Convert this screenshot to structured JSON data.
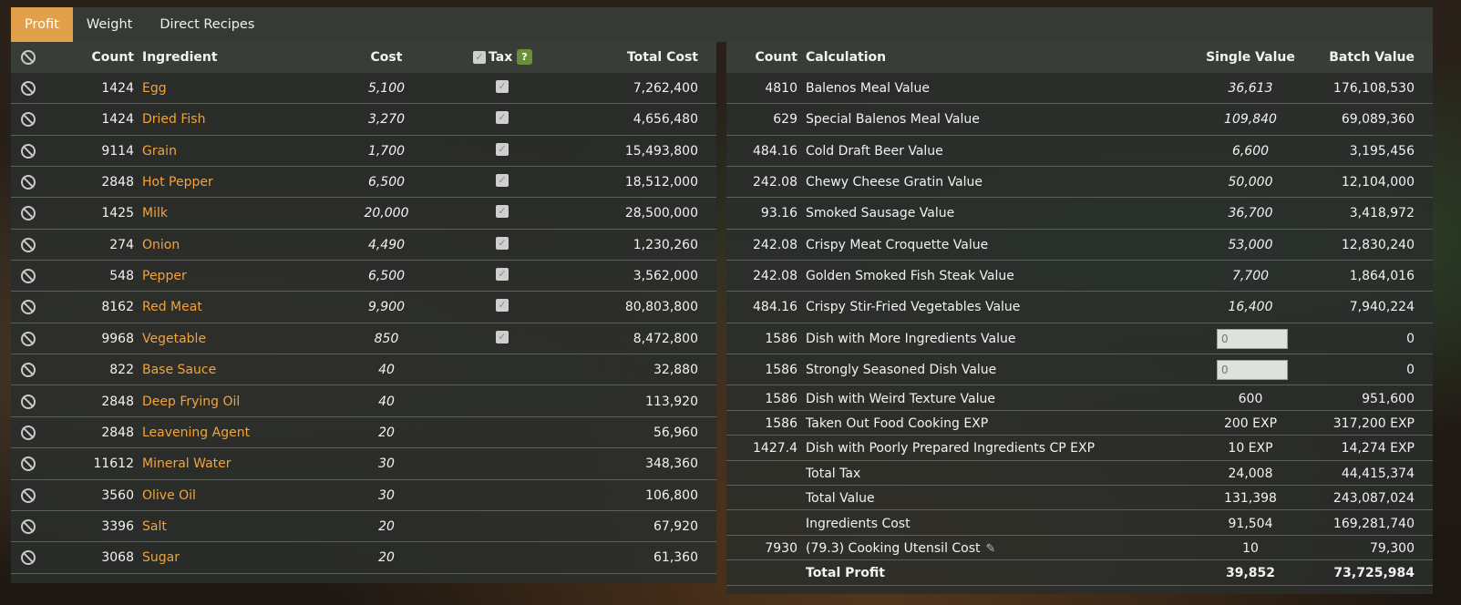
{
  "tabs": [
    "Profit",
    "Weight",
    "Direct Recipes"
  ],
  "left": {
    "headers": {
      "count": "Count",
      "ingredient": "Ingredient",
      "cost": "Cost",
      "tax": "Tax",
      "tax_help": "?",
      "total_cost": "Total Cost"
    },
    "rows": [
      {
        "count": "1424",
        "name": "Egg",
        "cost": "5,100",
        "taxed": true,
        "total": "7,262,400"
      },
      {
        "count": "1424",
        "name": "Dried Fish",
        "cost": "3,270",
        "taxed": true,
        "total": "4,656,480"
      },
      {
        "count": "9114",
        "name": "Grain",
        "cost": "1,700",
        "taxed": true,
        "total": "15,493,800"
      },
      {
        "count": "2848",
        "name": "Hot Pepper",
        "cost": "6,500",
        "taxed": true,
        "total": "18,512,000"
      },
      {
        "count": "1425",
        "name": "Milk",
        "cost": "20,000",
        "taxed": true,
        "total": "28,500,000"
      },
      {
        "count": "274",
        "name": "Onion",
        "cost": "4,490",
        "taxed": true,
        "total": "1,230,260"
      },
      {
        "count": "548",
        "name": "Pepper",
        "cost": "6,500",
        "taxed": true,
        "total": "3,562,000"
      },
      {
        "count": "8162",
        "name": "Red Meat",
        "cost": "9,900",
        "taxed": true,
        "total": "80,803,800"
      },
      {
        "count": "9968",
        "name": "Vegetable",
        "cost": "850",
        "taxed": true,
        "total": "8,472,800"
      },
      {
        "count": "822",
        "name": "Base Sauce",
        "cost": "40",
        "taxed": false,
        "total": "32,880"
      },
      {
        "count": "2848",
        "name": "Deep Frying Oil",
        "cost": "40",
        "taxed": false,
        "total": "113,920"
      },
      {
        "count": "2848",
        "name": "Leavening Agent",
        "cost": "20",
        "taxed": false,
        "total": "56,960"
      },
      {
        "count": "11612",
        "name": "Mineral Water",
        "cost": "30",
        "taxed": false,
        "total": "348,360"
      },
      {
        "count": "3560",
        "name": "Olive Oil",
        "cost": "30",
        "taxed": false,
        "total": "106,800"
      },
      {
        "count": "3396",
        "name": "Salt",
        "cost": "20",
        "taxed": false,
        "total": "67,920"
      },
      {
        "count": "3068",
        "name": "Sugar",
        "cost": "20",
        "taxed": false,
        "total": "61,360"
      }
    ]
  },
  "right": {
    "headers": {
      "count": "Count",
      "calculation": "Calculation",
      "single": "Single Value",
      "batch": "Batch Value"
    },
    "value_rows": [
      {
        "count": "4810",
        "name": "Balenos Meal Value",
        "single": "36,613",
        "batch": "176,108,530"
      },
      {
        "count": "629",
        "name": "Special Balenos Meal Value",
        "single": "109,840",
        "batch": "69,089,360"
      },
      {
        "count": "484.16",
        "name": "Cold Draft Beer Value",
        "single": "6,600",
        "batch": "3,195,456"
      },
      {
        "count": "242.08",
        "name": "Chewy Cheese Gratin Value",
        "single": "50,000",
        "batch": "12,104,000"
      },
      {
        "count": "93.16",
        "name": "Smoked Sausage Value",
        "single": "36,700",
        "batch": "3,418,972"
      },
      {
        "count": "242.08",
        "name": "Crispy Meat Croquette Value",
        "single": "53,000",
        "batch": "12,830,240"
      },
      {
        "count": "242.08",
        "name": "Golden Smoked Fish Steak Value",
        "single": "7,700",
        "batch": "1,864,016"
      },
      {
        "count": "484.16",
        "name": "Crispy Stir-Fried Vegetables Value",
        "single": "16,400",
        "batch": "7,940,224"
      }
    ],
    "input_rows": [
      {
        "count": "1586",
        "name": "Dish with More Ingredients Value",
        "placeholder": "0",
        "batch": "0"
      },
      {
        "count": "1586",
        "name": "Strongly Seasoned Dish Value",
        "placeholder": "0",
        "batch": "0"
      }
    ],
    "small_rows": [
      {
        "count": "1586",
        "name": "Dish with Weird Texture Value",
        "single": "600",
        "batch": "951,600"
      },
      {
        "count": "1586",
        "name": "Taken Out Food Cooking EXP",
        "single": "200 EXP",
        "batch": "317,200 EXP"
      },
      {
        "count": "1427.4",
        "name": "Dish with Poorly Prepared Ingredients CP EXP",
        "single": "10 EXP",
        "batch": "14,274 EXP"
      },
      {
        "count": "",
        "name": "Total Tax",
        "single": "24,008",
        "batch": "44,415,374"
      },
      {
        "count": "",
        "name": "Total Value",
        "single": "131,398",
        "batch": "243,087,024"
      },
      {
        "count": "",
        "name": "Ingredients Cost",
        "single": "91,504",
        "batch": "169,281,740"
      },
      {
        "count": "7930",
        "name": "(79.3) Cooking Utensil Cost",
        "single": "10",
        "batch": "79,300"
      },
      {
        "count": "",
        "name": "Total Profit",
        "single": "39,852",
        "batch": "73,725,984"
      }
    ]
  }
}
